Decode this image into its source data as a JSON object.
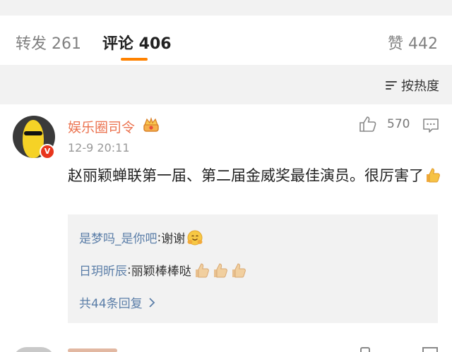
{
  "tabs": {
    "repost": "转发 261",
    "comment": "评论 406",
    "like": "赞 442"
  },
  "sort": {
    "label": "按热度"
  },
  "comment": {
    "username": "娱乐圈司令",
    "timestamp": "12-9 20:11",
    "like_count": "570",
    "text": "赵丽颖蝉联第一届、第二届金威奖最佳演员。很厉害了",
    "badge": "V",
    "replies": [
      {
        "user": "是梦吗_是你吧",
        "sep": ": ",
        "text": "谢谢"
      },
      {
        "user": "日玥昕辰",
        "sep": ": ",
        "text": "丽颖棒棒哒"
      }
    ],
    "more_replies": "共44条回复"
  },
  "colors": {
    "accent": "#ff8200",
    "username": "#eb7350",
    "link_blue": "#5b7ea8",
    "muted": "#999999"
  },
  "icons": [
    "crown-icon",
    "thumb-up-icon",
    "comment-icon",
    "sort-icon",
    "chevron-right-icon",
    "thumbs-up-emoji",
    "hug-emoji"
  ]
}
